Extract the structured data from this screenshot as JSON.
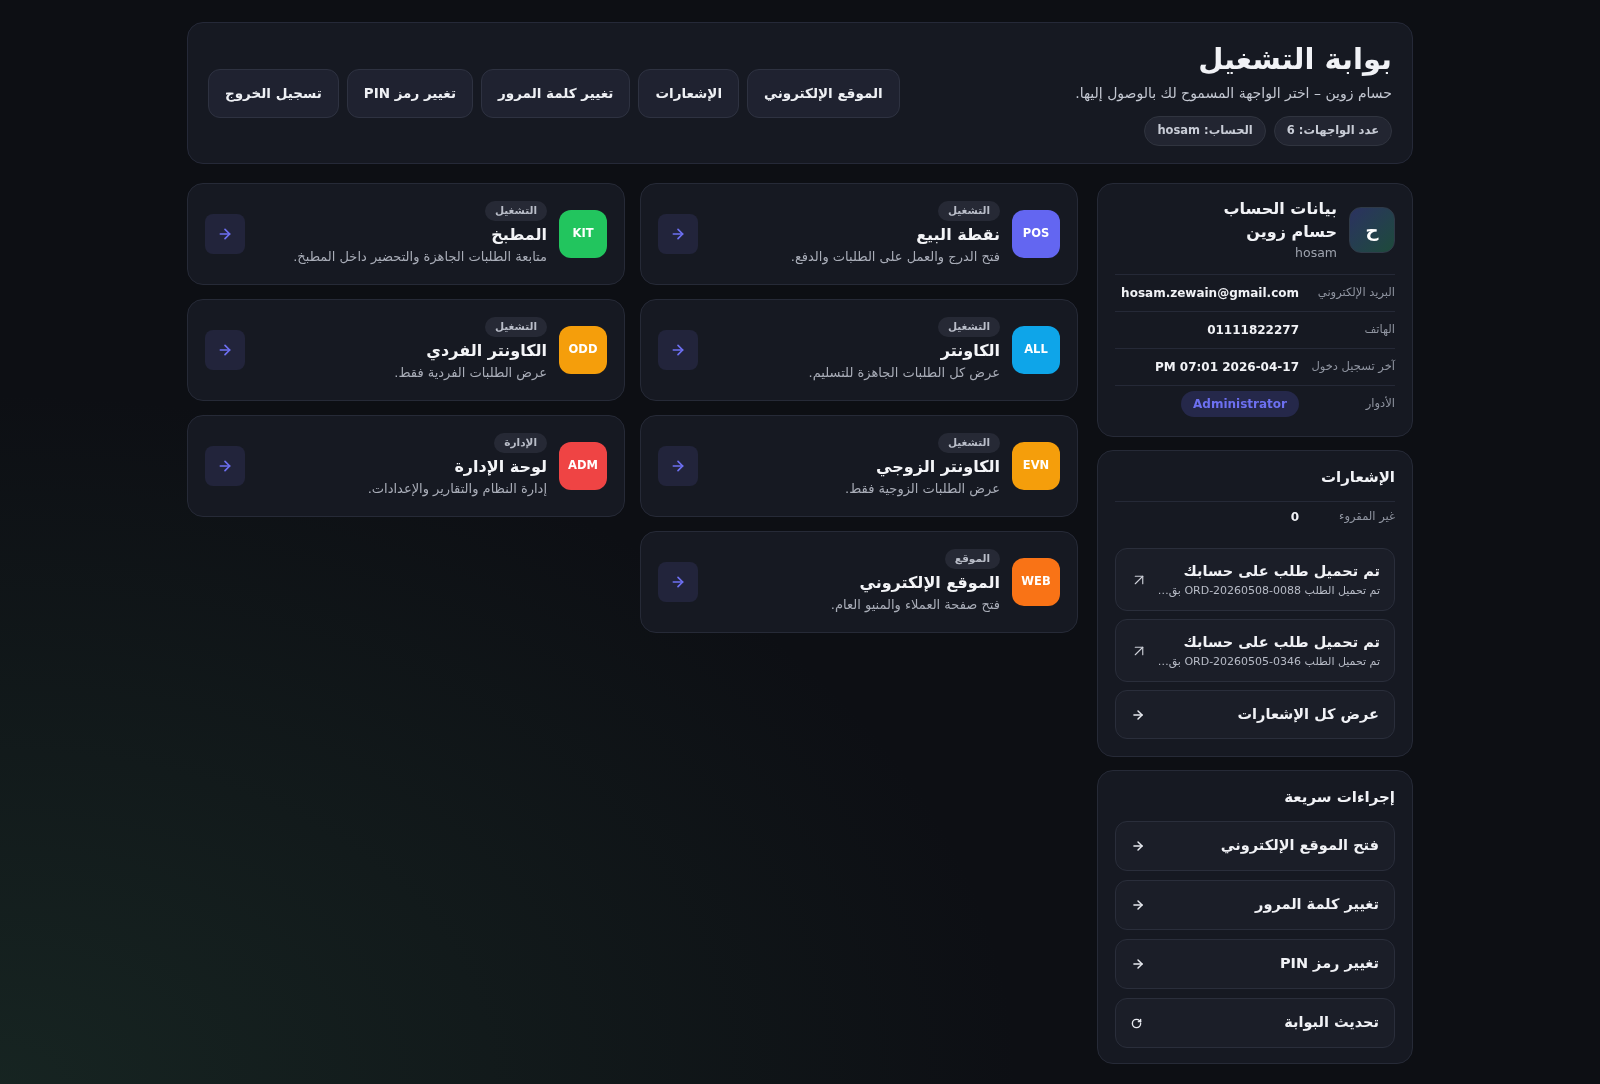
{
  "header": {
    "title": "بوابة التشغيل",
    "subtitle": "حسام زوين – اختر الواجهة المسموح لك بالوصول إليها.",
    "chips": [
      "عدد الواجهات: 6",
      "الحساب: hosam"
    ],
    "buttons": [
      "الموقع الإلكتروني",
      "الإشعارات",
      "تغيير كلمة المرور",
      "تغيير رمز PIN",
      "تسجيل الخروج"
    ]
  },
  "interfaces": [
    {
      "code": "POS",
      "color": "#6366f1",
      "category": "التشغيل",
      "title": "نقطة البيع",
      "description": "فتح الدرج والعمل على الطلبات والدفع."
    },
    {
      "code": "KIT",
      "color": "#22c55e",
      "category": "التشغيل",
      "title": "المطبخ",
      "description": "متابعة الطلبات الجاهزة والتحضير داخل المطبخ."
    },
    {
      "code": "ALL",
      "color": "#0ea5e9",
      "category": "التشغيل",
      "title": "الكاونتر",
      "description": "عرض كل الطلبات الجاهزة للتسليم."
    },
    {
      "code": "ODD",
      "color": "#f59e0b",
      "category": "التشغيل",
      "title": "الكاونتر الفردي",
      "description": "عرض الطلبات الفردية فقط."
    },
    {
      "code": "EVN",
      "color": "#f59e0b",
      "category": "التشغيل",
      "title": "الكاونتر الزوجي",
      "description": "عرض الطلبات الزوجية فقط."
    },
    {
      "code": "ADM",
      "color": "#ef4444",
      "category": "الإدارة",
      "title": "لوحة الإدارة",
      "description": "إدارة النظام والتقارير والإعدادات."
    },
    {
      "code": "WEB",
      "color": "#f97316",
      "category": "الموقع",
      "title": "الموقع الإلكتروني",
      "description": "فتح صفحة العملاء والمنيو العام."
    }
  ],
  "account": {
    "title": "بيانات الحساب",
    "avatar": "ح",
    "name": "حسام زوين",
    "username": "hosam",
    "fields": [
      {
        "label": "البريد الإلكتروني",
        "value": "hosam.zewain@gmail.com"
      },
      {
        "label": "الهاتف",
        "value": "01111822277"
      },
      {
        "label": "آخر تسجيل دخول",
        "value": "PM 07:01 2026-04-17"
      }
    ],
    "roles_label": "الأدوار",
    "roles": [
      "Administrator"
    ]
  },
  "notifications": {
    "title": "الإشعارات",
    "unread_label": "غير المقروء",
    "unread": "0",
    "items": [
      {
        "title": "تم تحميل طلب على حسابك",
        "text": "تم تحميل الطلب ORD-20260508-0088 بق…"
      },
      {
        "title": "تم تحميل طلب على حسابك",
        "text": "تم تحميل الطلب ORD-20260505-0346 بق…"
      }
    ],
    "view_all": "عرض كل الإشعارات"
  },
  "quick_actions": {
    "title": "إجراءات سريعة",
    "items": [
      {
        "label": "فتح الموقع الإلكتروني",
        "kind": "link"
      },
      {
        "label": "تغيير كلمة المرور",
        "kind": "link"
      },
      {
        "label": "تغيير رمز PIN",
        "kind": "link"
      },
      {
        "label": "تحديث البوابة",
        "kind": "refresh"
      }
    ]
  }
}
